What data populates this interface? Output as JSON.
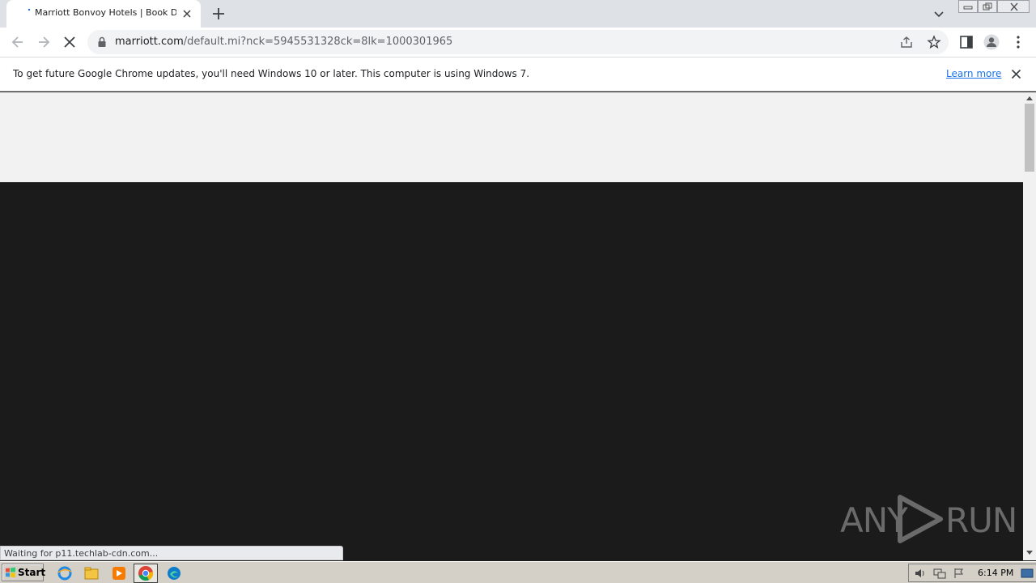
{
  "tab": {
    "title": "Marriott Bonvoy Hotels | Book Direct"
  },
  "address_bar": {
    "host": "marriott.com",
    "path": "/default.mi?nck=5945531328ck=8lk=1000301965"
  },
  "infobar": {
    "message": "To get future Google Chrome updates, you'll need Windows 10 or later. This computer is using Windows 7.",
    "link_label": "Learn more"
  },
  "status": {
    "text": "Waiting for p11.techlab-cdn.com..."
  },
  "watermark": {
    "left": "ANY",
    "right": "RUN"
  },
  "taskbar": {
    "start_label": "Start",
    "clock": "6:14 PM",
    "pinned": [
      "ie-icon",
      "explorer-icon",
      "media-player-icon",
      "chrome-icon",
      "edge-icon"
    ]
  },
  "colors": {
    "accent": "#1a73e8",
    "page_dark": "#1b1b1c",
    "page_light": "#f2f2f2"
  }
}
